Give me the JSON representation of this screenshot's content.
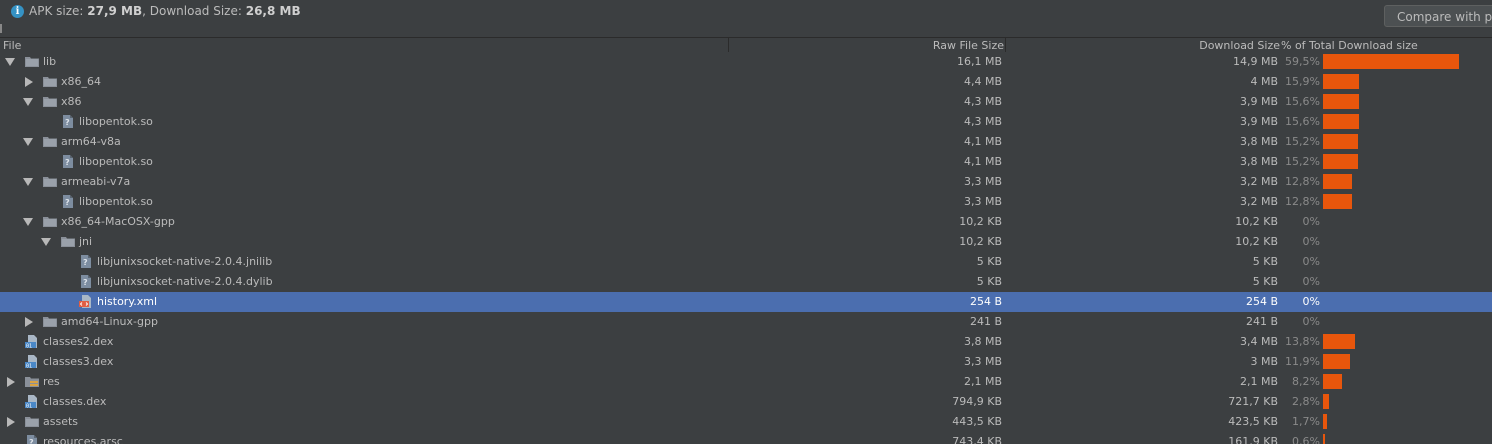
{
  "summary": {
    "apk_label": "APK size: ",
    "apk_value": "27,9 MB",
    "sep": ", Download Size: ",
    "dl_value": "26,8 MB"
  },
  "toolbar": {
    "compare_label": "Compare with pre"
  },
  "columns": {
    "file": "File",
    "raw": "Raw File Size",
    "download": "Download Size",
    "percent": "% of Total Download size"
  },
  "colors": {
    "bar": "#e8560c",
    "selection": "#4b6eaf",
    "folder_icon": "#8a9099",
    "file_icon": "#7d8da0",
    "xml_icon": "#e05d44",
    "dex_icon": "#4a88c7"
  },
  "rows": [
    {
      "name": "lib",
      "depth": 0,
      "toggle": "expanded",
      "icon": "folder-icon",
      "raw": "16,1 MB",
      "download": "14,9 MB",
      "percent": "59,5%",
      "share": 59.5,
      "selected": false
    },
    {
      "name": "x86_64",
      "depth": 1,
      "toggle": "collapsed",
      "icon": "folder-icon",
      "raw": "4,4 MB",
      "download": "4 MB",
      "percent": "15,9%",
      "share": 15.9,
      "selected": false
    },
    {
      "name": "x86",
      "depth": 1,
      "toggle": "expanded",
      "icon": "folder-icon",
      "raw": "4,3 MB",
      "download": "3,9 MB",
      "percent": "15,6%",
      "share": 15.6,
      "selected": false
    },
    {
      "name": "libopentok.so",
      "depth": 2,
      "toggle": "none",
      "icon": "unknown-file-icon",
      "raw": "4,3 MB",
      "download": "3,9 MB",
      "percent": "15,6%",
      "share": 15.6,
      "selected": false
    },
    {
      "name": "arm64-v8a",
      "depth": 1,
      "toggle": "expanded",
      "icon": "folder-icon",
      "raw": "4,1 MB",
      "download": "3,8 MB",
      "percent": "15,2%",
      "share": 15.2,
      "selected": false
    },
    {
      "name": "libopentok.so",
      "depth": 2,
      "toggle": "none",
      "icon": "unknown-file-icon",
      "raw": "4,1 MB",
      "download": "3,8 MB",
      "percent": "15,2%",
      "share": 15.2,
      "selected": false
    },
    {
      "name": "armeabi-v7a",
      "depth": 1,
      "toggle": "expanded",
      "icon": "folder-icon",
      "raw": "3,3 MB",
      "download": "3,2 MB",
      "percent": "12,8%",
      "share": 12.8,
      "selected": false
    },
    {
      "name": "libopentok.so",
      "depth": 2,
      "toggle": "none",
      "icon": "unknown-file-icon",
      "raw": "3,3 MB",
      "download": "3,2 MB",
      "percent": "12,8%",
      "share": 12.8,
      "selected": false
    },
    {
      "name": "x86_64-MacOSX-gpp",
      "depth": 1,
      "toggle": "expanded",
      "icon": "folder-icon",
      "raw": "10,2 KB",
      "download": "10,2 KB",
      "percent": "0%",
      "share": 0,
      "selected": false
    },
    {
      "name": "jni",
      "depth": 2,
      "toggle": "expanded",
      "icon": "folder-icon",
      "raw": "10,2 KB",
      "download": "10,2 KB",
      "percent": "0%",
      "share": 0,
      "selected": false
    },
    {
      "name": "libjunixsocket-native-2.0.4.jnilib",
      "depth": 3,
      "toggle": "none",
      "icon": "unknown-file-icon",
      "raw": "5 KB",
      "download": "5 KB",
      "percent": "0%",
      "share": 0,
      "selected": false
    },
    {
      "name": "libjunixsocket-native-2.0.4.dylib",
      "depth": 3,
      "toggle": "none",
      "icon": "unknown-file-icon",
      "raw": "5 KB",
      "download": "5 KB",
      "percent": "0%",
      "share": 0,
      "selected": false
    },
    {
      "name": "history.xml",
      "depth": 3,
      "toggle": "none",
      "icon": "xml-file-icon",
      "raw": "254 B",
      "download": "254 B",
      "percent": "0%",
      "share": 0,
      "selected": true
    },
    {
      "name": "amd64-Linux-gpp",
      "depth": 1,
      "toggle": "collapsed",
      "icon": "folder-icon",
      "raw": "241 B",
      "download": "241 B",
      "percent": "0%",
      "share": 0,
      "selected": false
    },
    {
      "name": "classes2.dex",
      "depth": 0,
      "toggle": "none",
      "icon": "dex-file-icon",
      "raw": "3,8 MB",
      "download": "3,4 MB",
      "percent": "13,8%",
      "share": 13.8,
      "selected": false
    },
    {
      "name": "classes3.dex",
      "depth": 0,
      "toggle": "none",
      "icon": "dex-file-icon",
      "raw": "3,3 MB",
      "download": "3 MB",
      "percent": "11,9%",
      "share": 11.9,
      "selected": false
    },
    {
      "name": "res",
      "depth": 0,
      "toggle": "collapsed",
      "icon": "res-folder-icon",
      "raw": "2,1 MB",
      "download": "2,1 MB",
      "percent": "8,2%",
      "share": 8.2,
      "selected": false
    },
    {
      "name": "classes.dex",
      "depth": 0,
      "toggle": "none",
      "icon": "dex-file-icon",
      "raw": "794,9 KB",
      "download": "721,7 KB",
      "percent": "2,8%",
      "share": 2.8,
      "selected": false
    },
    {
      "name": "assets",
      "depth": 0,
      "toggle": "collapsed",
      "icon": "folder-icon",
      "raw": "443,5 KB",
      "download": "423,5 KB",
      "percent": "1,7%",
      "share": 1.7,
      "selected": false
    },
    {
      "name": "resources.arsc",
      "depth": 0,
      "toggle": "none",
      "icon": "unknown-file-icon",
      "raw": "743,4 KB",
      "download": "161,9 KB",
      "percent": "0,6%",
      "share": 0.6,
      "selected": false
    }
  ]
}
